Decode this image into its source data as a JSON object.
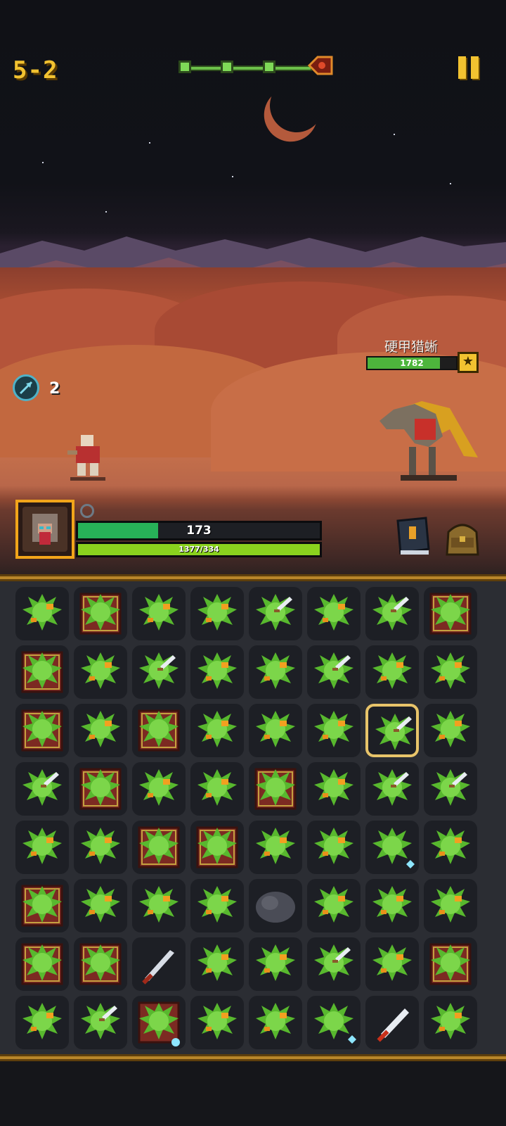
{
  "level": "5-2",
  "stage_progress": {
    "nodes_total": 4,
    "current_node": 4
  },
  "skill": {
    "icon": "arrow-skill-icon",
    "count": "2"
  },
  "enemy": {
    "name": "硬甲猎蜥",
    "hp": "1782",
    "hp_fraction": 0.82,
    "rank_icon": "star-icon"
  },
  "player": {
    "hp": "173",
    "hp_fraction": 0.33,
    "xp": "1377/334",
    "xp_fraction": 1.0
  },
  "colors": {
    "gold": "#f2c230",
    "hp_green": "#27b158",
    "xp_green": "#8ad21e",
    "board_bg": "#2b2d33"
  },
  "board": {
    "rows": [
      [
        "slime-orange",
        "slime-crate",
        "slime-orange",
        "slime-orange",
        "slime-sword",
        "slime-orange",
        "slime-sword",
        "slime-crate"
      ],
      [
        "slime-crate",
        "slime-orange",
        "slime-sword",
        "slime-orange",
        "slime-orange",
        "slime-sword",
        "slime-orange",
        "slime-orange"
      ],
      [
        "slime-crate",
        "slime-orange",
        "slime-crate",
        "slime-orange",
        "slime-orange",
        "slime-orange",
        "slime-sword",
        "slime-orange"
      ],
      [
        "slime-sword",
        "slime-crate",
        "slime-orange",
        "slime-orange",
        "slime-crate",
        "slime-orange",
        "slime-sword",
        "slime-sword"
      ],
      [
        "slime-orange",
        "slime-orange",
        "slime-crate",
        "slime-crate",
        "slime-orange",
        "slime-orange",
        "slime-ice",
        "slime-orange"
      ],
      [
        "slime-crate",
        "slime-orange",
        "slime-orange",
        "slime-orange",
        "rock",
        "slime-orange",
        "slime-orange",
        "slime-orange"
      ],
      [
        "slime-crate",
        "slime-crate",
        "dagger",
        "slime-orange",
        "slime-orange",
        "slime-sword",
        "slime-orange",
        "slime-crate"
      ],
      [
        "slime-orange",
        "slime-sword",
        "slime-crate-spark",
        "slime-orange",
        "slime-orange",
        "slime-ice",
        "sword",
        "slime-orange"
      ]
    ],
    "selected": [
      2,
      6
    ]
  }
}
